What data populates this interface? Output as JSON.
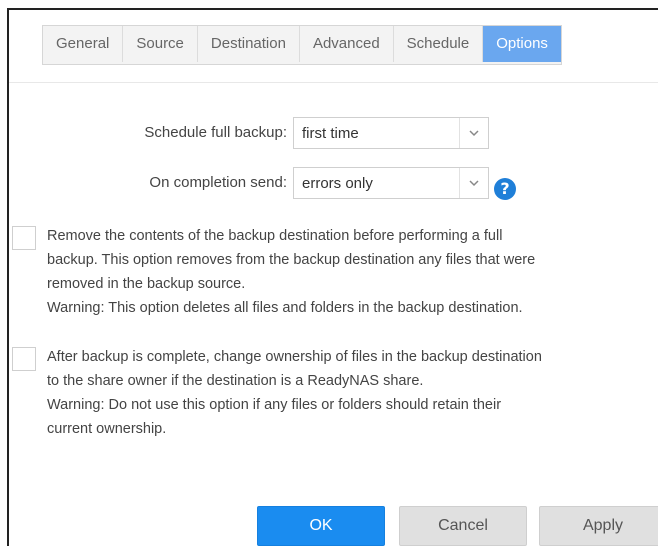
{
  "tabs": [
    {
      "label": "General",
      "active": false
    },
    {
      "label": "Source",
      "active": false
    },
    {
      "label": "Destination",
      "active": false
    },
    {
      "label": "Advanced",
      "active": false
    },
    {
      "label": "Schedule",
      "active": false
    },
    {
      "label": "Options",
      "active": true
    }
  ],
  "fields": {
    "schedule_full_backup": {
      "label": "Schedule full backup:",
      "value": "first time"
    },
    "on_completion_send": {
      "label": "On completion send:",
      "value": "errors only"
    }
  },
  "options": [
    {
      "checked": false,
      "lines": [
        "Remove the contents of the backup destination before performing a full",
        "backup. This option removes from the backup destination any files that were",
        "removed in the backup source.",
        "Warning: This option deletes all files and folders in the backup destination."
      ]
    },
    {
      "checked": false,
      "lines": [
        "After backup is complete, change ownership of files in the backup destination",
        "to the share owner if the destination is a ReadyNAS share.",
        "Warning: Do not use this option if any files or folders should retain their",
        "current ownership."
      ]
    }
  ],
  "help_icon": "question-mark",
  "buttons": {
    "ok": "OK",
    "cancel": "Cancel",
    "apply": "Apply"
  },
  "colors": {
    "accent": "#1a8cf0",
    "active_tab": "#6aa7ef",
    "help": "#1f7fd8"
  }
}
